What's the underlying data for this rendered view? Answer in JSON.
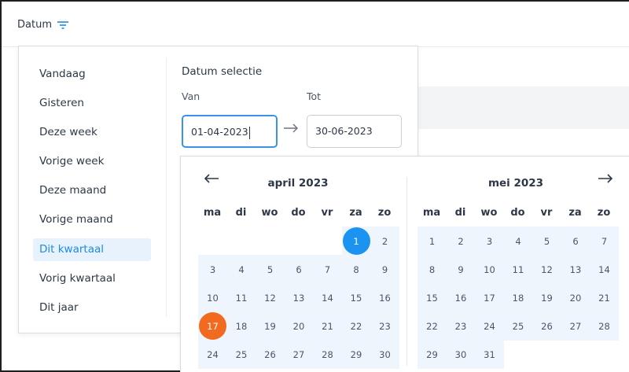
{
  "header": {
    "filter_label": "Datum"
  },
  "presets": [
    {
      "label": "Vandaag",
      "active": false
    },
    {
      "label": "Gisteren",
      "active": false
    },
    {
      "label": "Deze week",
      "active": false
    },
    {
      "label": "Vorige week",
      "active": false
    },
    {
      "label": "Deze maand",
      "active": false
    },
    {
      "label": "Vorige maand",
      "active": false
    },
    {
      "label": "Dit kwartaal",
      "active": true
    },
    {
      "label": "Vorig kwartaal",
      "active": false
    },
    {
      "label": "Dit jaar",
      "active": false
    }
  ],
  "selection": {
    "title": "Datum selectie",
    "from_label": "Van",
    "to_label": "Tot",
    "from_value": "01-04-2023",
    "to_value": "30-06-2023"
  },
  "calendar": {
    "weekdays": [
      "ma",
      "di",
      "wo",
      "do",
      "vr",
      "za",
      "zo"
    ],
    "months": [
      {
        "title": "april 2023",
        "weeks": [
          [
            "",
            "",
            "",
            "",
            "",
            "1",
            "2"
          ],
          [
            "3",
            "4",
            "5",
            "6",
            "7",
            "8",
            "9"
          ],
          [
            "10",
            "11",
            "12",
            "13",
            "14",
            "15",
            "16"
          ],
          [
            "17",
            "18",
            "19",
            "20",
            "21",
            "22",
            "23"
          ],
          [
            "24",
            "25",
            "26",
            "27",
            "28",
            "29",
            "30"
          ]
        ]
      },
      {
        "title": "mei 2023",
        "weeks": [
          [
            "1",
            "2",
            "3",
            "4",
            "5",
            "6",
            "7"
          ],
          [
            "8",
            "9",
            "10",
            "11",
            "12",
            "13",
            "14"
          ],
          [
            "15",
            "16",
            "17",
            "18",
            "19",
            "20",
            "21"
          ],
          [
            "22",
            "23",
            "24",
            "25",
            "26",
            "27",
            "28"
          ],
          [
            "29",
            "30",
            "31",
            "",
            "",
            "",
            ""
          ]
        ]
      }
    ],
    "range_start": "1",
    "today": "17"
  },
  "colors": {
    "accent": "#1c93f0",
    "today": "#f26a1f",
    "range_bg": "#eef5fd"
  }
}
